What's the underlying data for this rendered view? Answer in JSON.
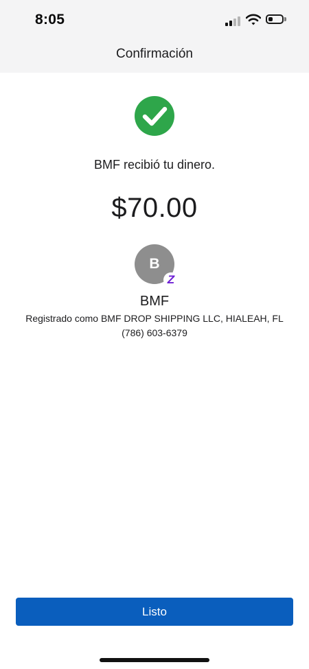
{
  "status_bar": {
    "time": "8:05",
    "signal_icon": "cellular-signal-icon",
    "wifi_icon": "wifi-icon",
    "battery_icon": "battery-icon",
    "battery_level": 0.35
  },
  "header": {
    "title": "Confirmación",
    "background": "#f4f4f5"
  },
  "confirmation": {
    "status_icon": "checkmark-circle-icon",
    "status_color": "#2ea64a",
    "message": "BMF recibió tu dinero.",
    "amount": "$70.00"
  },
  "recipient": {
    "avatar_initial": "B",
    "avatar_color": "#8e8e8e",
    "badge_icon": "zelle-icon",
    "badge_glyph": "Z",
    "badge_color": "#6d1ed4",
    "name": "BMF",
    "registered_as": "Registrado como BMF DROP SHIPPING LLC, HIALEAH, FL",
    "phone": "(786) 603-6379"
  },
  "footer": {
    "done_label": "Listo",
    "button_color": "#0a5ebd"
  }
}
